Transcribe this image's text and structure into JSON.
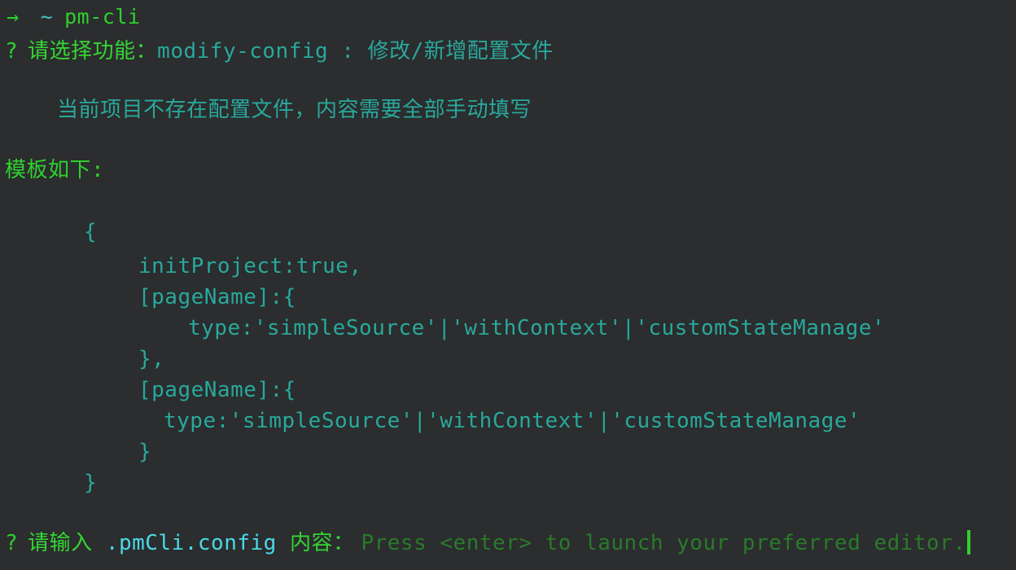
{
  "terminal": {
    "background_color": "#2b2d2e",
    "colors": {
      "green": "#2fd02f",
      "green_dim": "#2a7a2a",
      "cyan": "#29a89c",
      "cyan_bright": "#4bd9e8"
    }
  },
  "shell_prompt": {
    "arrow": "→",
    "path": "~",
    "command": "pm-cli"
  },
  "select_prompt": {
    "marker": "?",
    "question": "请选择功能：",
    "answer": "modify-config : 修改/新增配置文件"
  },
  "notice": {
    "text": "当前项目不存在配置文件，内容需要全部手动填写"
  },
  "template_heading": {
    "text": "模板如下:"
  },
  "template_body": {
    "lines": [
      "{",
      "initProject:true,",
      "[pageName]:{",
      "type:'simpleSource'|'withContext'|'customStateManage'",
      "},",
      "[pageName]:{",
      "type:'simpleSource'|'withContext'|'customStateManage'",
      "}",
      "}"
    ]
  },
  "input_prompt": {
    "marker": "?",
    "question_prefix": "请输入 ",
    "filename": ".pmCli.config",
    "question_suffix": " 内容：",
    "hint": "Press <enter> to launch your preferred editor."
  }
}
